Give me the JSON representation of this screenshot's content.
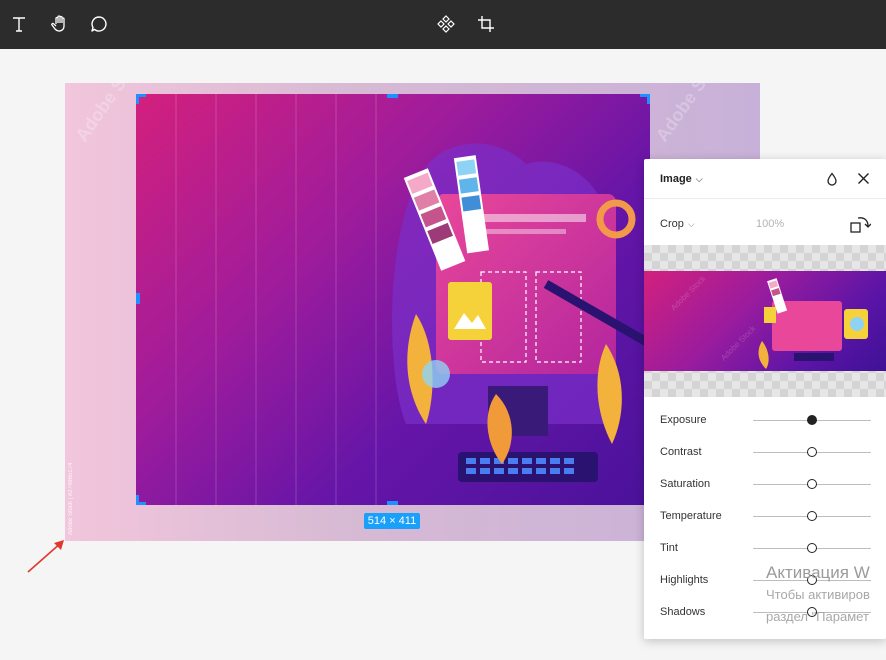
{
  "toolbar": {
    "tools": [
      "text-tool",
      "hand-tool",
      "comment-tool",
      "component-tool",
      "crop-tool"
    ]
  },
  "canvas": {
    "watermark": "Adobe Stock | #274865174",
    "selection_size": "514 × 411"
  },
  "panel": {
    "title": "Image",
    "crop_label": "Crop",
    "zoom": "100%",
    "adjustments": [
      {
        "label": "Exposure",
        "value": 0.5,
        "filled": true
      },
      {
        "label": "Contrast",
        "value": 0.5,
        "filled": false
      },
      {
        "label": "Saturation",
        "value": 0.5,
        "filled": false
      },
      {
        "label": "Temperature",
        "value": 0.5,
        "filled": false
      },
      {
        "label": "Tint",
        "value": 0.5,
        "filled": false
      },
      {
        "label": "Highlights",
        "value": 0.5,
        "filled": false
      },
      {
        "label": "Shadows",
        "value": 0.5,
        "filled": false
      }
    ]
  },
  "os_overlay": {
    "line1": "Активация W",
    "line2": "Чтобы активиров",
    "line3": "раздел \"Парамет"
  },
  "colors": {
    "toolbar_bg": "#2c2c2c",
    "accent": "#18a0fb",
    "annotation_arrow": "#e0382e"
  }
}
